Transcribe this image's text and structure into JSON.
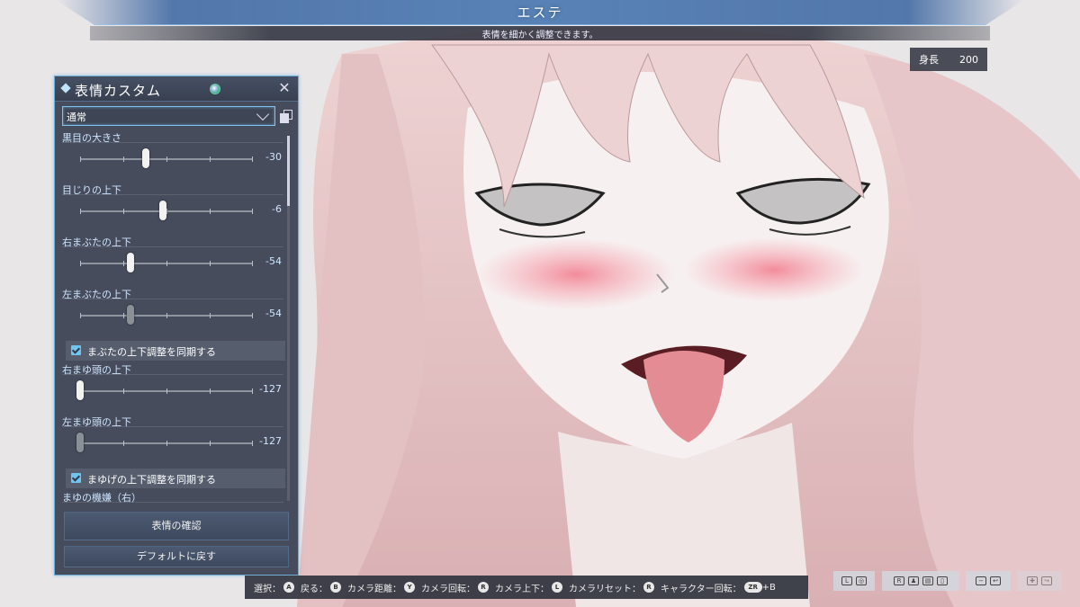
{
  "header": {
    "title": "エステ",
    "subtitle": "表情を細かく調整できます。"
  },
  "height_box": {
    "label": "身長",
    "value": "200"
  },
  "panel": {
    "title": "表情カスタム",
    "dropdown_value": "通常",
    "sliders": [
      {
        "label": "黒目の大きさ",
        "value": "-30",
        "fraction": 0.38,
        "dim": false
      },
      {
        "label": "目じりの上下",
        "value": "-6",
        "fraction": 0.48,
        "dim": false
      },
      {
        "label": "右まぶたの上下",
        "value": "-54",
        "fraction": 0.29,
        "dim": false
      },
      {
        "label": "左まぶたの上下",
        "value": "-54",
        "fraction": 0.29,
        "dim": true
      }
    ],
    "check_eyelid": "まぶたの上下調整を同期する",
    "sliders2": [
      {
        "label": "右まゆ頭の上下",
        "value": "-127",
        "fraction": 0.0,
        "dim": false
      },
      {
        "label": "左まゆ頭の上下",
        "value": "-127",
        "fraction": 0.0,
        "dim": true
      }
    ],
    "check_brow": "まゆげの上下調整を同期する",
    "partial_label": "まゆの機嫌（右）",
    "confirm_button": "表情の確認",
    "default_button": "デフォルトに戻す"
  },
  "guide": {
    "select": "選択：",
    "back": "戻る：",
    "cam_distance": "カメラ距離：",
    "cam_rotate": "カメラ回転：",
    "cam_updown": "カメラ上下：",
    "cam_reset": "カメラリセット：",
    "char_rotate": "キャラクター回転：",
    "btn_a": "A",
    "btn_b": "B",
    "btn_y": "Y",
    "btn_zr": "ZR",
    "plus_b": "+B"
  },
  "icons": [
    "gem-icon",
    "close-icon",
    "chevron-down-icon",
    "copy-icon",
    "checkbox-icon"
  ],
  "colors": {
    "accent": "#7cc3ef",
    "panel": "#3e4656",
    "hair": "#e9c9c9",
    "skin": "#f5eeee"
  }
}
